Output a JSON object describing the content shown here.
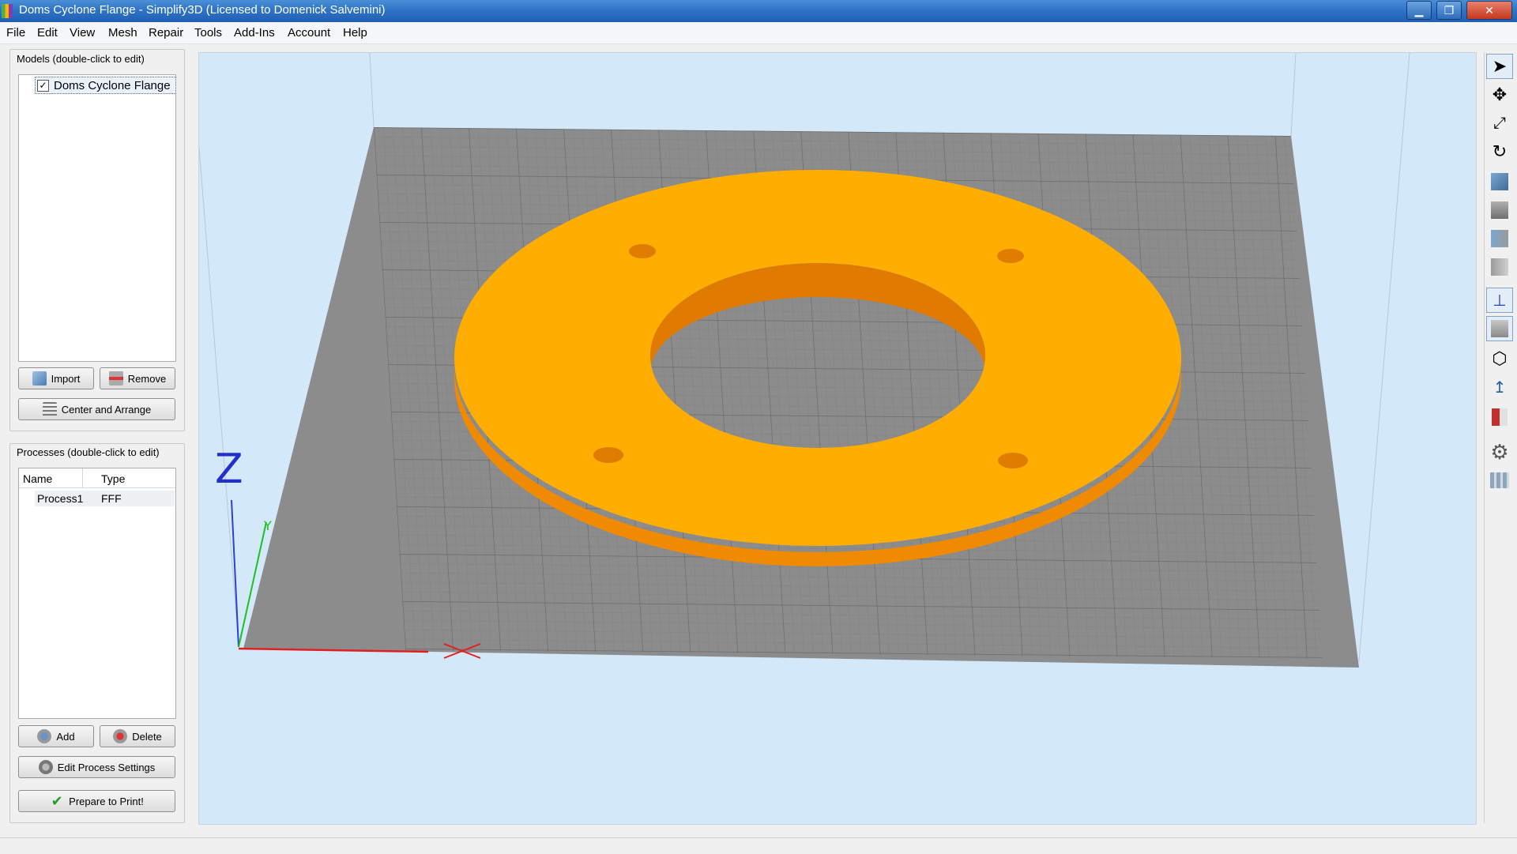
{
  "window": {
    "title": "Doms Cyclone Flange - Simplify3D (Licensed to Domenick Salvemini)",
    "min_glyph": "▁",
    "max_glyph": "❐",
    "close_glyph": "✕"
  },
  "menu": [
    "File",
    "Edit",
    "View",
    "Mesh",
    "Repair",
    "Tools",
    "Add-Ins",
    "Account",
    "Help"
  ],
  "models": {
    "label": "Models (double-click to edit)",
    "items": [
      {
        "name": "Doms Cyclone Flange",
        "checked": true
      }
    ],
    "import_label": "Import",
    "remove_label": "Remove",
    "center_label": "Center and Arrange"
  },
  "processes": {
    "label": "Processes (double-click to edit)",
    "columns": [
      "Name",
      "Type"
    ],
    "rows": [
      {
        "name": "Process1",
        "type": "FFF"
      }
    ],
    "add_label": "Add",
    "delete_label": "Delete",
    "edit_label": "Edit Process Settings",
    "prepare_label": "Prepare to Print!"
  },
  "viewport": {
    "axis_z": "Z",
    "axis_y": "Y",
    "model_color": "#ffad00",
    "bed_color": "#8c8c8c",
    "background": "#d3e8f8"
  },
  "toolbar_icons": [
    "select-icon",
    "move-icon",
    "scale-icon",
    "rotate-icon",
    "default-view-icon",
    "front-view-icon",
    "left-view-icon",
    "right-view-icon",
    "show-axes-icon",
    "solid-view-icon",
    "wireframe-view-icon",
    "normals-icon",
    "cross-section-icon",
    "settings-icon",
    "build-table-icon"
  ]
}
